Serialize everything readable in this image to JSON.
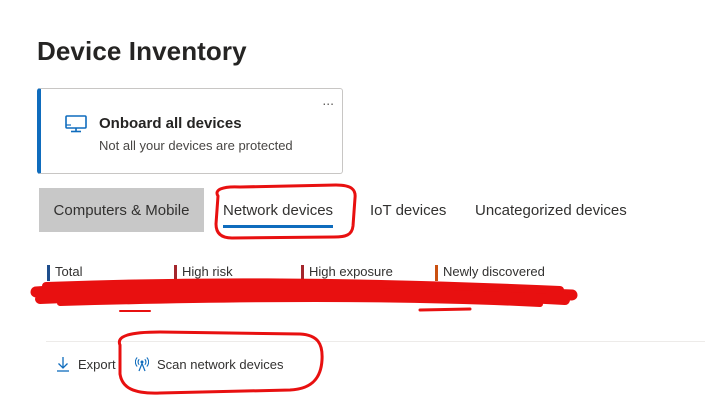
{
  "page": {
    "title": "Device Inventory"
  },
  "onboard_card": {
    "title": "Onboard all devices",
    "subtitle": "Not all your devices are protected",
    "more_label": "...",
    "icon": "monitor-icon"
  },
  "tabs": [
    {
      "label": "Computers & Mobile"
    },
    {
      "label": "Network devices"
    },
    {
      "label": "IoT devices"
    },
    {
      "label": "Uncategorized devices"
    }
  ],
  "stats": [
    {
      "label": "Total",
      "color": "#1e4e8c"
    },
    {
      "label": "High risk",
      "color": "#a4262c"
    },
    {
      "label": "High exposure",
      "color": "#a4262c"
    },
    {
      "label": "Newly discovered",
      "color": "#ca5010"
    }
  ],
  "commands": {
    "export_label": "Export",
    "scan_label": "Scan network devices"
  },
  "colors": {
    "accent": "#0f6cbd",
    "annotation": "#e81010"
  }
}
